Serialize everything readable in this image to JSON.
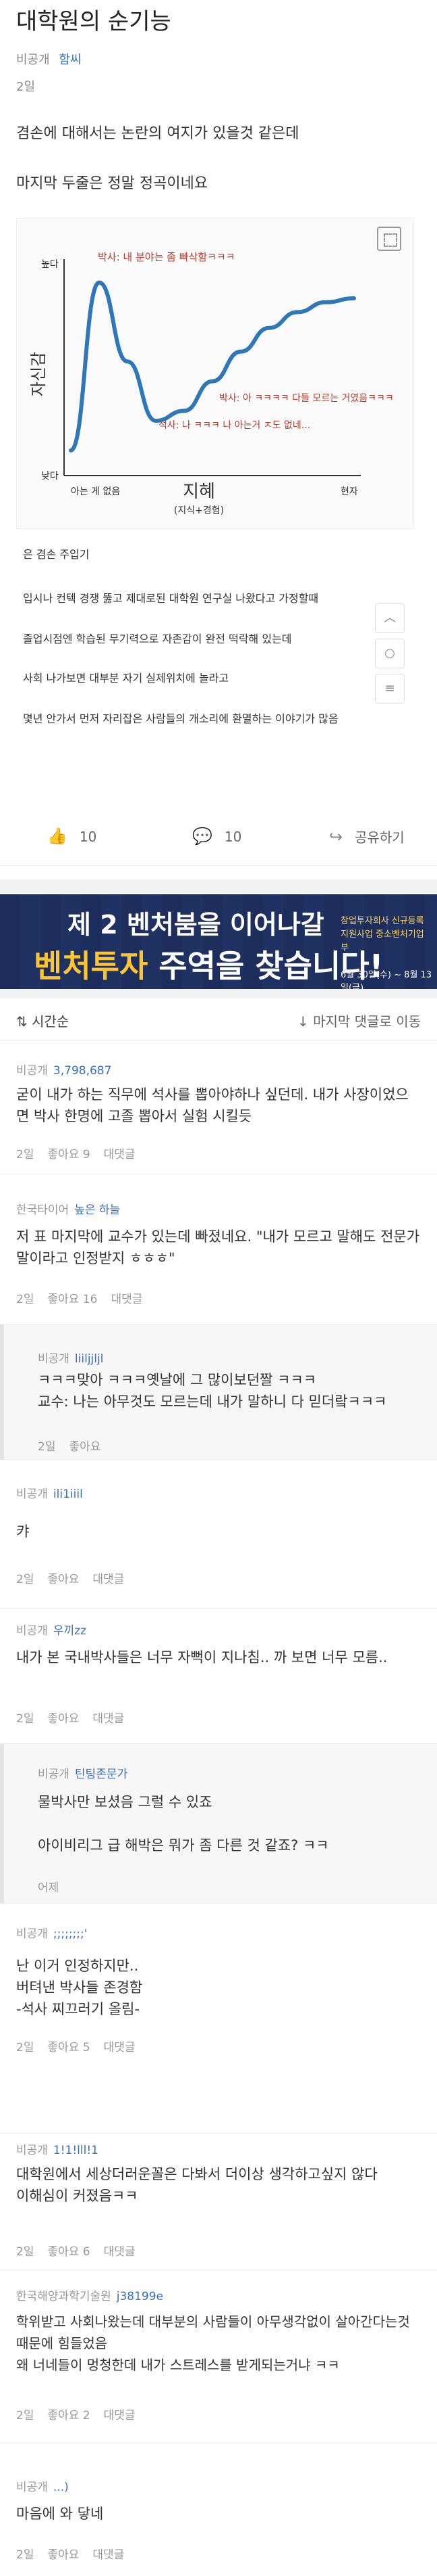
{
  "post": {
    "title": "대학원의 순기능",
    "visibility": "비공개",
    "author": "함씨",
    "date": "2일",
    "line1": "겸손에 대해서는 논란의 여지가 있을것 같은데",
    "line2": "마지막 두줄은 정말 정곡이네요"
  },
  "chart_data": {
    "type": "line",
    "ylabel": "자신감",
    "xlabel": "지혜",
    "xsub": "(지식+경험)",
    "y_high": "높다",
    "y_low": "낮다",
    "x_start": "아는 게 없음",
    "x_end": "현자",
    "annotations": [
      "박사: 내 분야는 좀 빠삭함ㅋㅋㅋ",
      "석사: 나 ㅋㅋㅋ 나 아는거 ㅈ도 없네...",
      "박사: 아 ㅋㅋㅋㅋ 다들 모르는 거였음ㅋㅋㅋ"
    ],
    "x": [
      0,
      1,
      2,
      3,
      4,
      5,
      6,
      7,
      8,
      9,
      10
    ],
    "values": [
      10,
      95,
      55,
      25,
      30,
      45,
      60,
      72,
      80,
      85,
      87
    ],
    "color": "#2f78b7"
  },
  "embed": {
    "lines": [
      "은 겸손 주입기",
      "입시나 컨텍 경쟁 뚫고 제대로된 대학원 연구실 나왔다고 가정할때",
      "졸업시점엔 학습된 무기력으로 자존감이 완전 떡락해 있는데",
      "사회 나가보면 대부분 자기 실제위치에 놀라고",
      "몇년 안가서 먼저 자리잡은 사람들의 개소리에 환멸하는 이야기가 많음"
    ]
  },
  "actions": {
    "like": "10",
    "comment": "10",
    "share": "공유하기"
  },
  "banner": {
    "line1": "제 2 벤처붐을 이어나갈",
    "line2a": "벤처투자 ",
    "line2b": "주역",
    "line2c": "을 찾습니다!",
    "side": "창업투자회사 신규등록 지원사업 중소벤처기업부",
    "date": "6월 30일(수) ~ 8월 13일(금)"
  },
  "sort": {
    "left": "시간순",
    "right": "마지막 댓글로 이동"
  },
  "comments": [
    {
      "org": "비공개",
      "nick": "3,798,687",
      "lines": [
        "굳이 내가 하는 직무에 석사를 뽑아야하나 싶던데. 내가 사장이었으면 박사 한명에 고졸 뽑아서 실험 시킬듯"
      ],
      "date": "2일",
      "like": "좋아요 9",
      "reply": "대댓글"
    },
    {
      "org": "한국타이어",
      "nick": "높은 하늘",
      "lines": [
        "저 표 마지막에 교수가 있는데 빠졌네요. \"내가 모르고 말해도 전문가 말이라고 인정받지 ㅎㅎㅎ\""
      ],
      "date": "2일",
      "like": "좋아요 16",
      "reply": "대댓글"
    },
    {
      "org": "비공개",
      "nick": "liiljjljl",
      "lines": [
        "ㅋㅋㅋ맞아 ㅋㅋㅋ옛날에 그 많이보던짤 ㅋㅋㅋ",
        "교수: 나는 아무것도 모르는데 내가 말하니 다 믿더랔ㅋㅋㅋ"
      ],
      "date": "2일",
      "like": "좋아요",
      "reply": ""
    },
    {
      "org": "비공개",
      "nick": "ili1iiil",
      "lines": [
        "캬"
      ],
      "date": "2일",
      "like": "좋아요",
      "reply": "대댓글"
    },
    {
      "org": "비공개",
      "nick": "우끼zz",
      "lines": [
        "내가 본 국내박사들은 너무 자뻑이 지나침.. 까 보면 너무 모름.."
      ],
      "date": "2일",
      "like": "좋아요",
      "reply": "대댓글"
    },
    {
      "org": "비공개",
      "nick": "틴팅존문가",
      "lines": [
        "물박사만 보셨음 그럴 수 있죠",
        "",
        "아이비리그 급 해박은 뭐가 좀 다른 것 같죠? ㅋㅋ"
      ],
      "date": "어제",
      "like": "",
      "reply": ""
    },
    {
      "org": "비공개",
      "nick": ";;;;;;;;'",
      "lines": [
        "난 이거 인정하지만..",
        "버텨낸 박사들 존경함",
        "-석사 찌끄러기 올림-"
      ],
      "date": "2일",
      "like": "좋아요 5",
      "reply": "대댓글"
    },
    {
      "org": "비공개",
      "nick": "1!1!lll!1",
      "lines": [
        "대학원에서 세상더러운꼴은 다봐서 더이상 생각하고싶지 않다",
        "이해심이 커졌음ㅋㅋ"
      ],
      "date": "2일",
      "like": "좋아요 6",
      "reply": "대댓글"
    },
    {
      "org": "한국해양과학기술원",
      "nick": "j38199e",
      "lines": [
        "학위받고 사회나왔는데 대부분의 사람들이 아무생각없이 살아간다는것때문에 힘들었음",
        "왜 너네들이 멍청한데 내가 스트레스를 받게되는거냐 ㅋㅋ"
      ],
      "date": "2일",
      "like": "좋아요 2",
      "reply": "대댓글"
    },
    {
      "org": "비공개",
      "nick": "...)",
      "lines": [
        "마음에 와 닿네"
      ],
      "date": "2일",
      "like": "좋아요",
      "reply": "대댓글"
    }
  ]
}
